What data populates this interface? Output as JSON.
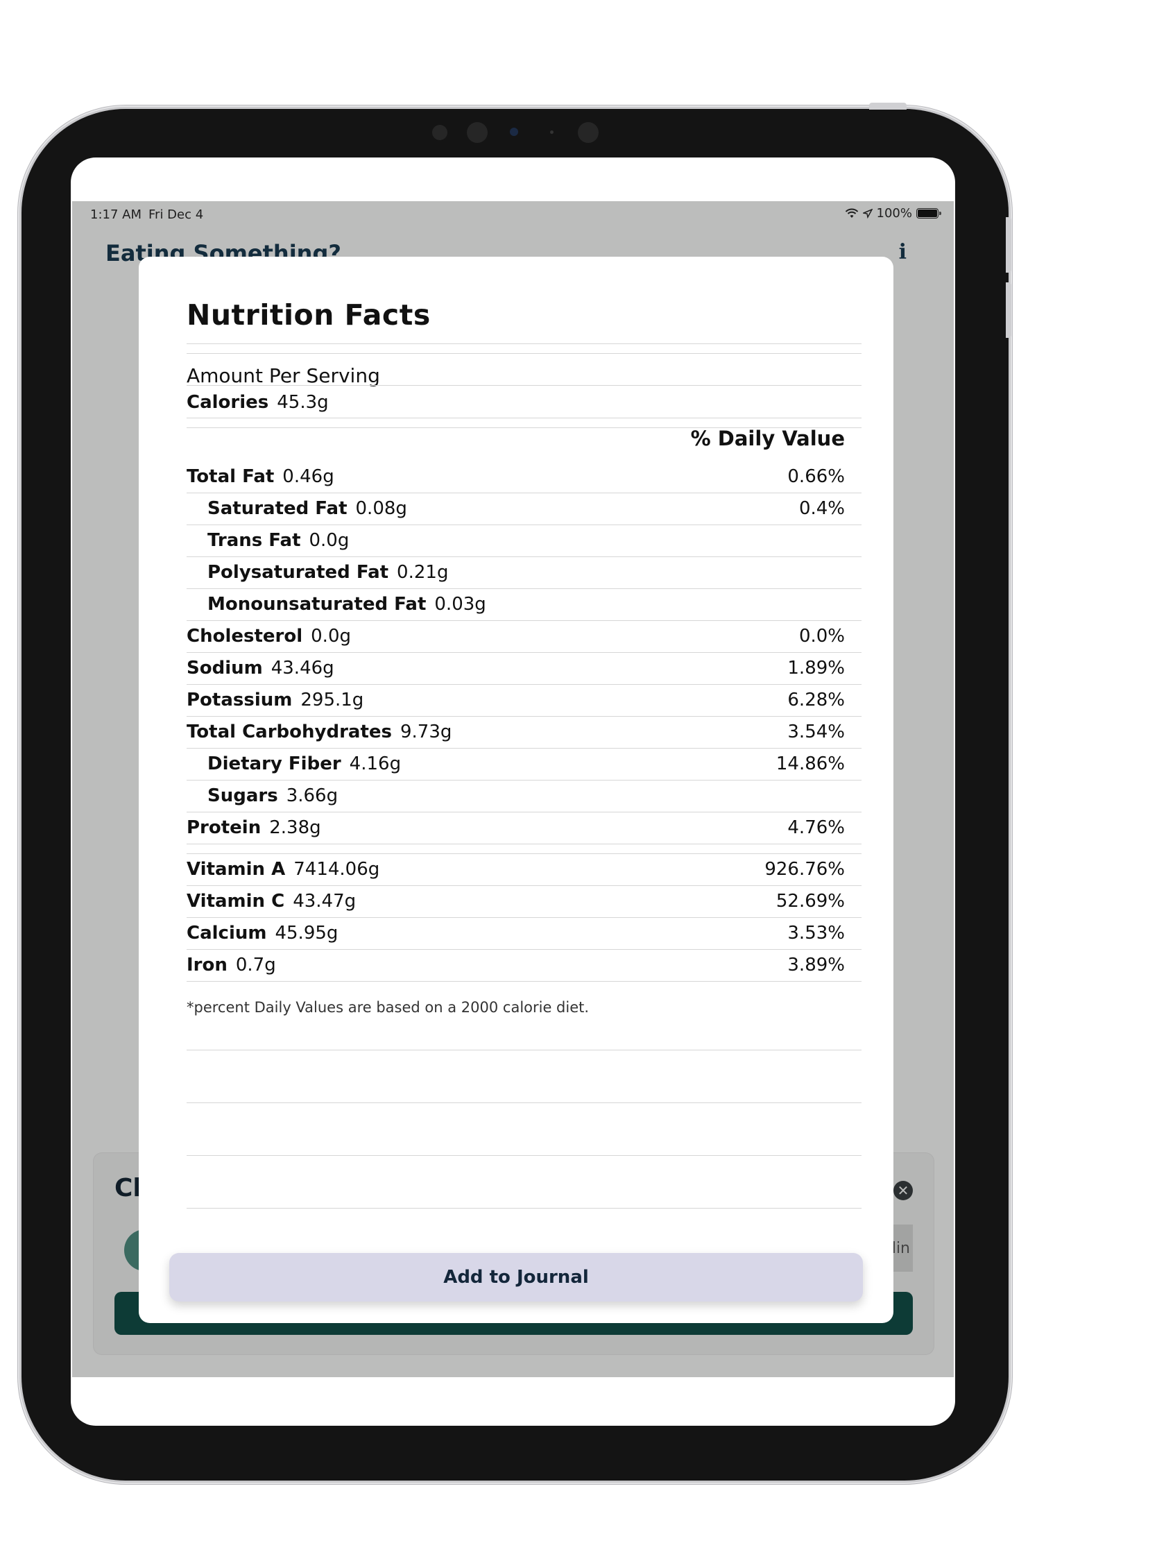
{
  "status_bar": {
    "time": "1:17 AM",
    "date": "Fri Dec 4",
    "battery": "100%"
  },
  "app": {
    "title": "Eating Something?",
    "info_icon": "i",
    "bottom_card": {
      "title": "Ch",
      "chip_text": "alin",
      "close_icon": "close-icon"
    }
  },
  "nutrition": {
    "title": "Nutrition Facts",
    "amount_per_serving": "Amount Per Serving",
    "calories_label": "Calories",
    "calories_value": "45.3g",
    "daily_value_header": "% Daily Value",
    "rows": [
      {
        "label": "Total Fat",
        "amount": "0.46g",
        "percent": "0.66%"
      },
      {
        "label": "Saturated Fat",
        "amount": "0.08g",
        "percent": "0.4%"
      },
      {
        "label": "Trans Fat",
        "amount": "0.0g",
        "percent": ""
      },
      {
        "label": "Polysaturated Fat",
        "amount": "0.21g",
        "percent": ""
      },
      {
        "label": "Monounsaturated Fat",
        "amount": "0.03g",
        "percent": ""
      },
      {
        "label": "Cholesterol",
        "amount": "0.0g",
        "percent": "0.0%"
      },
      {
        "label": "Sodium",
        "amount": "43.46g",
        "percent": "1.89%"
      },
      {
        "label": "Potassium",
        "amount": "295.1g",
        "percent": "6.28%"
      },
      {
        "label": "Total Carbohydrates",
        "amount": "9.73g",
        "percent": "3.54%"
      },
      {
        "label": "Dietary Fiber",
        "amount": "4.16g",
        "percent": "14.86%"
      },
      {
        "label": "Sugars",
        "amount": "3.66g",
        "percent": ""
      },
      {
        "label": "Protein",
        "amount": "2.38g",
        "percent": "4.76%"
      }
    ],
    "vitamins": [
      {
        "label": "Vitamin A",
        "amount": "7414.06g",
        "percent": "926.76%"
      },
      {
        "label": "Vitamin C",
        "amount": "43.47g",
        "percent": "52.69%"
      },
      {
        "label": "Calcium",
        "amount": "45.95g",
        "percent": "3.53%"
      },
      {
        "label": "Iron",
        "amount": "0.7g",
        "percent": "3.89%"
      }
    ],
    "footnote": "*percent Daily Values are based on a 2000 calorie diet.",
    "add_button": "Add to Journal"
  },
  "colors": {
    "dim_background": "#bcbdbc",
    "title_navy": "#132c3d",
    "button_lavender": "#d8d7e8",
    "card_button_green": "#0d3b36"
  }
}
